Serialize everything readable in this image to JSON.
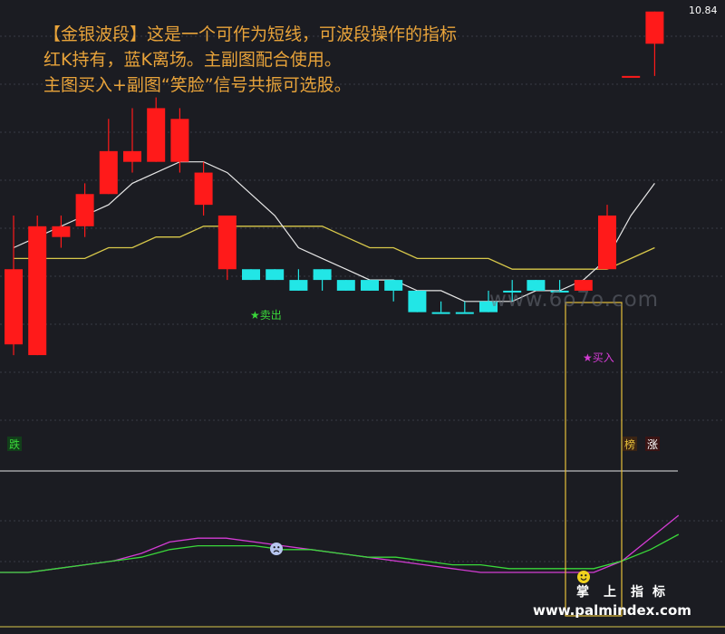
{
  "caption": {
    "line1": "【金银波段】这是一个可作为短线，可波段操作的指标",
    "line2": "红K持有，蓝K离场。主副图配合使用。",
    "line3": "主图买入+副图“笑脸”信号共振可选股。"
  },
  "price_label": "10.84",
  "watermark_main": "www.6o7o.com",
  "watermark_bottom": "www.palmindex.com",
  "brand_chars": [
    "掌",
    "上",
    "指",
    "标"
  ],
  "sell_label": "★卖出",
  "buy_label": "★买入",
  "tag_left": "跌",
  "tag_right_1": "榜",
  "tag_right_2": "涨",
  "colors": {
    "background": "#1b1c22",
    "up_candle": "#ff1a1a",
    "down_candle": "#22e6e6",
    "ma_white": "#e6e6e6",
    "ma_yellow": "#d8c84a",
    "osc_magenta": "#d43cd4",
    "osc_green": "#3ad83a",
    "box_line": "#e6bf3a",
    "caption": "#e8a33a",
    "sell_text": "#3ad83a",
    "buy_text": "#d43cd4"
  },
  "chart_data": [
    {
      "type": "candlestick",
      "title": "",
      "candles": [
        {
          "o": 8.4,
          "h": 8.9,
          "l": 7.6,
          "c": 7.7,
          "color": "red"
        },
        {
          "o": 8.8,
          "h": 8.9,
          "l": 7.6,
          "c": 7.6,
          "color": "red"
        },
        {
          "o": 8.7,
          "h": 8.9,
          "l": 8.6,
          "c": 8.8,
          "color": "red"
        },
        {
          "o": 8.8,
          "h": 9.2,
          "l": 8.7,
          "c": 9.1,
          "color": "red"
        },
        {
          "o": 9.1,
          "h": 9.8,
          "l": 9.1,
          "c": 9.5,
          "color": "red"
        },
        {
          "o": 9.4,
          "h": 9.9,
          "l": 9.3,
          "c": 9.5,
          "color": "red"
        },
        {
          "o": 9.4,
          "h": 10.0,
          "l": 9.4,
          "c": 9.9,
          "color": "red"
        },
        {
          "o": 9.4,
          "h": 9.9,
          "l": 9.3,
          "c": 9.8,
          "color": "red"
        },
        {
          "o": 9.3,
          "h": 9.4,
          "l": 8.9,
          "c": 9.0,
          "color": "red"
        },
        {
          "o": 8.9,
          "h": 8.9,
          "l": 8.3,
          "c": 8.4,
          "color": "red"
        },
        {
          "o": 8.4,
          "h": 8.4,
          "l": 8.3,
          "c": 8.3,
          "color": "cyan"
        },
        {
          "o": 8.4,
          "h": 8.4,
          "l": 8.3,
          "c": 8.3,
          "color": "cyan"
        },
        {
          "o": 8.3,
          "h": 8.4,
          "l": 8.2,
          "c": 8.2,
          "color": "cyan"
        },
        {
          "o": 8.4,
          "h": 8.4,
          "l": 8.2,
          "c": 8.3,
          "color": "cyan"
        },
        {
          "o": 8.3,
          "h": 8.3,
          "l": 8.2,
          "c": 8.2,
          "color": "cyan"
        },
        {
          "o": 8.3,
          "h": 8.3,
          "l": 8.2,
          "c": 8.2,
          "color": "cyan"
        },
        {
          "o": 8.3,
          "h": 8.3,
          "l": 8.1,
          "c": 8.2,
          "color": "cyan"
        },
        {
          "o": 8.2,
          "h": 8.2,
          "l": 8.0,
          "c": 8.0,
          "color": "cyan"
        },
        {
          "o": 8.0,
          "h": 8.1,
          "l": 8.0,
          "c": 8.0,
          "color": "cyan"
        },
        {
          "o": 8.0,
          "h": 8.1,
          "l": 8.0,
          "c": 8.0,
          "color": "cyan"
        },
        {
          "o": 8.1,
          "h": 8.2,
          "l": 8.0,
          "c": 8.0,
          "color": "cyan"
        },
        {
          "o": 8.2,
          "h": 8.3,
          "l": 8.1,
          "c": 8.2,
          "color": "cyan"
        },
        {
          "o": 8.3,
          "h": 8.3,
          "l": 8.2,
          "c": 8.2,
          "color": "cyan"
        },
        {
          "o": 8.2,
          "h": 8.3,
          "l": 8.2,
          "c": 8.2,
          "color": "cyan"
        },
        {
          "o": 8.3,
          "h": 8.3,
          "l": 8.2,
          "c": 8.2,
          "color": "red"
        },
        {
          "o": 8.4,
          "h": 9.0,
          "l": 8.4,
          "c": 8.9,
          "color": "red"
        },
        {
          "o": 10.2,
          "h": 10.2,
          "l": 10.2,
          "c": 10.2,
          "color": "red"
        },
        {
          "o": 10.5,
          "h": 10.8,
          "l": 10.2,
          "c": 10.8,
          "color": "red"
        }
      ],
      "ma_white": [
        8.6,
        8.7,
        8.8,
        8.9,
        9.0,
        9.2,
        9.3,
        9.4,
        9.4,
        9.3,
        9.1,
        8.9,
        8.6,
        8.5,
        8.4,
        8.3,
        8.3,
        8.2,
        8.2,
        8.1,
        8.1,
        8.1,
        8.2,
        8.2,
        8.3,
        8.5,
        8.9,
        9.2
      ],
      "ma_yellow": [
        8.5,
        8.5,
        8.5,
        8.5,
        8.6,
        8.6,
        8.7,
        8.7,
        8.8,
        8.8,
        8.8,
        8.8,
        8.8,
        8.8,
        8.7,
        8.6,
        8.6,
        8.5,
        8.5,
        8.5,
        8.5,
        8.4,
        8.4,
        8.4,
        8.4,
        8.4,
        8.5,
        8.6
      ],
      "y_max_label": 10.84
    },
    {
      "type": "line",
      "series": [
        {
          "values": [
            0.0,
            0.0,
            0.1,
            0.2,
            0.3,
            0.5,
            0.8,
            0.9,
            0.9,
            0.8,
            0.7,
            0.6,
            0.5,
            0.4,
            0.3,
            0.2,
            0.1,
            0.0,
            0.0,
            0.0,
            0.0,
            0.0,
            0.3,
            0.9,
            1.5
          ]
        },
        {
          "values": [
            0.0,
            0.0,
            0.1,
            0.2,
            0.3,
            0.4,
            0.6,
            0.7,
            0.7,
            0.7,
            0.6,
            0.6,
            0.5,
            0.4,
            0.4,
            0.3,
            0.2,
            0.2,
            0.1,
            0.1,
            0.1,
            0.1,
            0.3,
            0.6,
            1.0
          ]
        }
      ]
    }
  ]
}
